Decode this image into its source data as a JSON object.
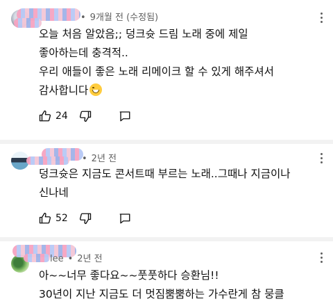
{
  "comments": [
    {
      "meta": {
        "time": "9개월 전",
        "edited": "(수정됨)"
      },
      "lines": [
        "오늘 처음 알았음;; 덩크슛 드림 노래 중에 제일",
        "좋아하는데 충격적..",
        "우리 애들이 좋은 노래 리메이크 할 수 있게 해주셔서",
        "감사합니다"
      ],
      "emoji": "grinning-sweat-emoji",
      "likes": "24"
    },
    {
      "meta": {
        "time": "2년 전"
      },
      "lines": [
        "덩크슛은 지금도 콘서트때 부르는 노래..그때나 지금이나",
        "신나네"
      ],
      "likes": "52"
    },
    {
      "meta": {
        "name_visible": "lee",
        "time": "2년 전"
      },
      "lines": [
        "아~~너무 좋다요~~풋풋하다 승환님!!",
        "30년이 지난 지금도 더 멋짐뿜뿜하는 가수란게 참 뭉클"
      ]
    }
  ],
  "colors": {
    "text": "#0f0f0f",
    "meta": "#606060",
    "divider": "#f2f2f2"
  },
  "icons": [
    "like-icon",
    "dislike-icon",
    "reply-icon",
    "more-options-icon"
  ]
}
